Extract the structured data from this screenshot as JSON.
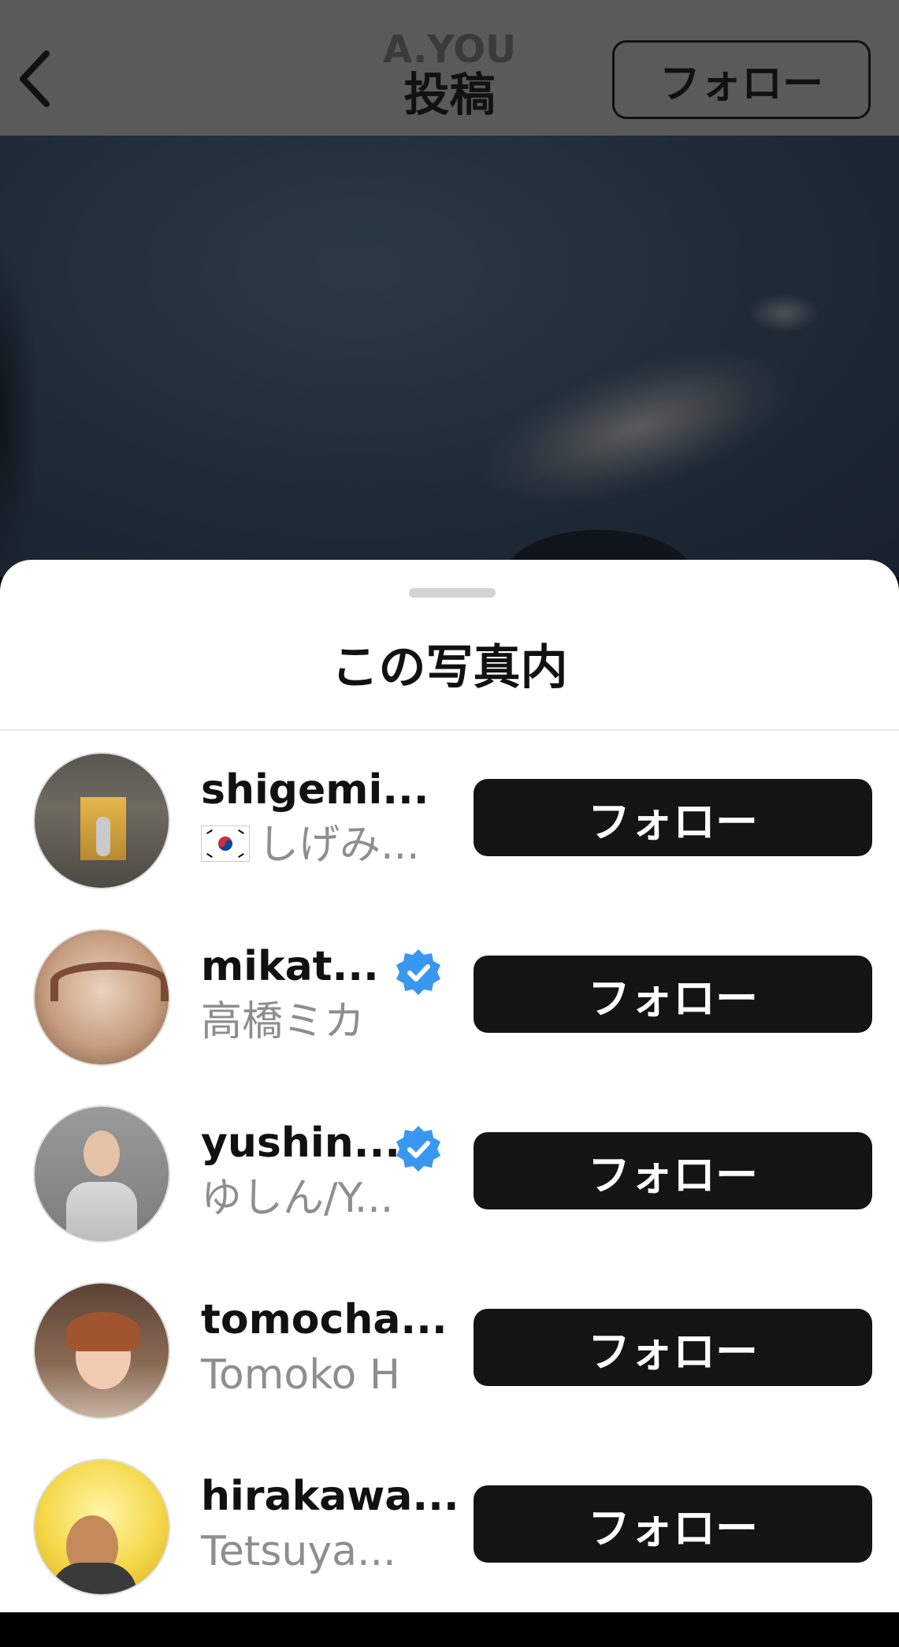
{
  "header": {
    "back_icon": "chevron-left-icon",
    "username": "A.YOU",
    "title": "投稿",
    "follow_label": "フォロー"
  },
  "sheet": {
    "title": "この写真内"
  },
  "users": [
    {
      "username": "shigemi...",
      "fullname": "しげみ...",
      "flag": "korea-flag-icon",
      "verified": false,
      "follow_label": "フォロー"
    },
    {
      "username": "mikat...",
      "fullname": "高橋ミカ",
      "verified": true,
      "follow_label": "フォロー"
    },
    {
      "username": "yushin...",
      "fullname": "ゆしん/Y...",
      "verified": true,
      "follow_label": "フォロー"
    },
    {
      "username": "tomocha...",
      "fullname": "Tomoko H",
      "verified": false,
      "follow_label": "フォロー"
    },
    {
      "username": "hirakawa...",
      "fullname": "Tetsuya...",
      "verified": false,
      "follow_label": "フォロー"
    }
  ],
  "colors": {
    "follow_button_bg": "#141414",
    "verified_badge": "#3897f0",
    "secondary_text": "#8e8e8e"
  }
}
